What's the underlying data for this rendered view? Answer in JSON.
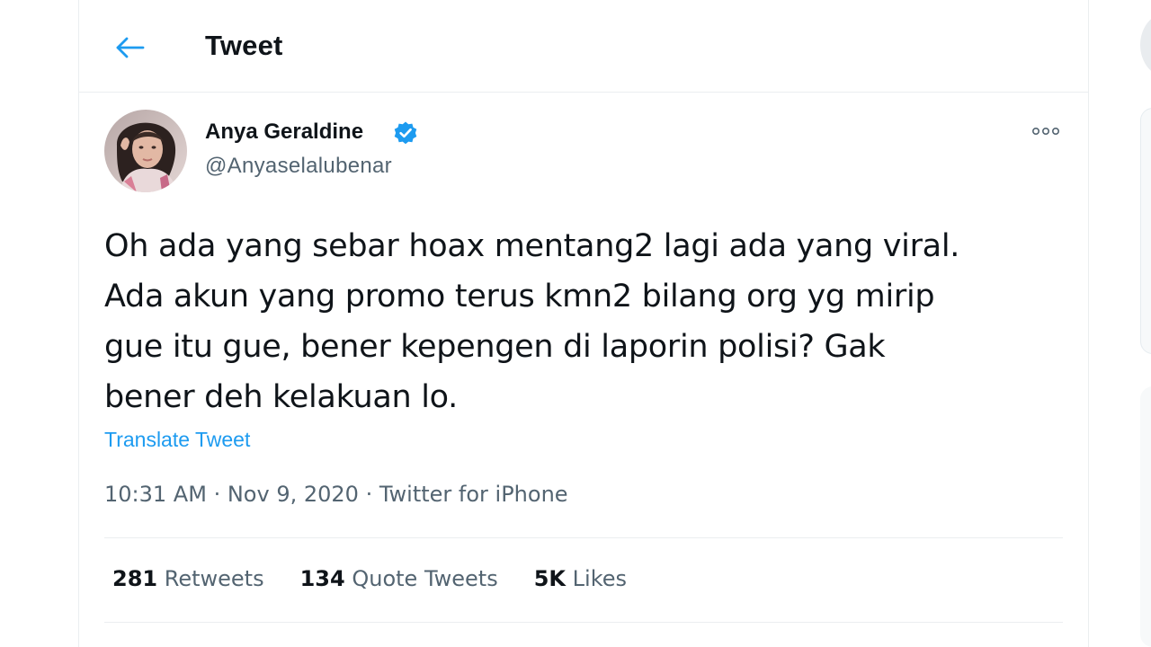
{
  "header": {
    "title": "Tweet",
    "back_icon": "arrow-left-icon"
  },
  "tweet": {
    "author": {
      "display_name": "Anya Geraldine",
      "handle": "@Anyaselalubenar",
      "verified": true
    },
    "text": "Oh ada yang sebar hoax mentang2 lagi ada yang viral.\nAda akun yang promo terus kmn2 bilang org yg mirip\ngue itu gue, bener kepengen di laporin polisi? Gak\nbener deh kelakuan lo.",
    "translate_label": "Translate Tweet",
    "time": "10:31 AM",
    "separator": "·",
    "date": "Nov 9, 2020",
    "source": "Twitter for iPhone",
    "stats": {
      "retweets_count": "281",
      "retweets_label": "Retweets",
      "quotes_count": "134",
      "quotes_label": "Quote Tweets",
      "likes_count": "5K",
      "likes_label": "Likes"
    }
  },
  "colors": {
    "accent": "#1d9bf0",
    "text_primary": "#0f1419",
    "text_secondary": "#536471",
    "border": "#ebeef0"
  }
}
